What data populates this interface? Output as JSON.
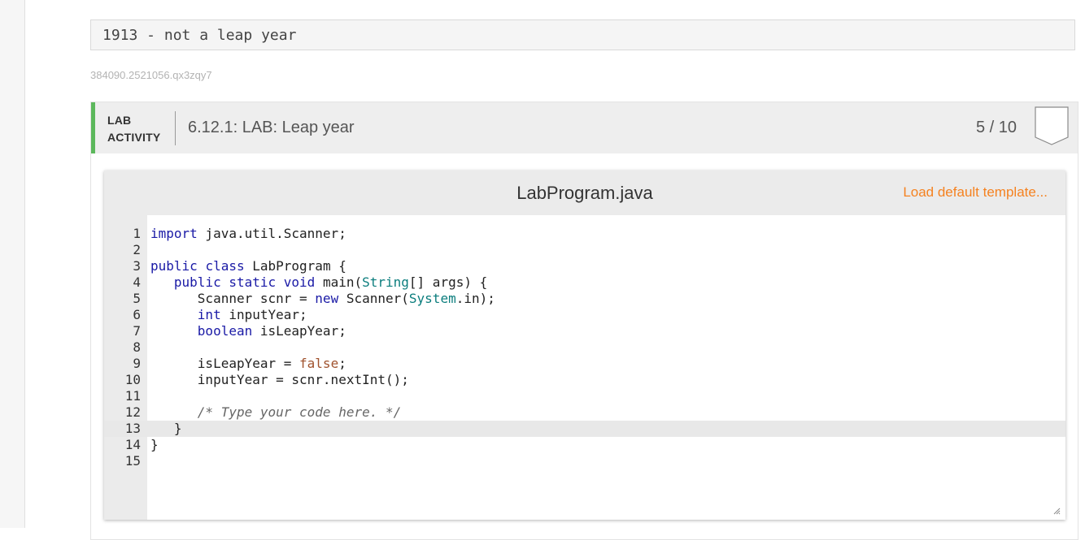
{
  "output": {
    "text": "1913 - not a leap year"
  },
  "activity_id": "384090.2521056.qx3zqy7",
  "lab": {
    "tag_line1": "LAB",
    "tag_line2": "ACTIVITY",
    "title": "6.12.1: LAB: Leap year",
    "score": "5 / 10",
    "accent_color": "#5cb85c"
  },
  "editor": {
    "file_name": "LabProgram.java",
    "load_template_label": "Load default template...",
    "load_template_color": "#f58220",
    "active_line": 13,
    "lines": [
      {
        "num": "1",
        "text": "import java.util.Scanner;"
      },
      {
        "num": "2",
        "text": ""
      },
      {
        "num": "3",
        "text": "public class LabProgram {"
      },
      {
        "num": "4",
        "text": "   public static void main(String[] args) {"
      },
      {
        "num": "5",
        "text": "      Scanner scnr = new Scanner(System.in);"
      },
      {
        "num": "6",
        "text": "      int inputYear;"
      },
      {
        "num": "7",
        "text": "      boolean isLeapYear;"
      },
      {
        "num": "8",
        "text": ""
      },
      {
        "num": "9",
        "text": "      isLeapYear = false;"
      },
      {
        "num": "10",
        "text": "      inputYear = scnr.nextInt();"
      },
      {
        "num": "11",
        "text": ""
      },
      {
        "num": "12",
        "text": "      /* Type your code here. */"
      },
      {
        "num": "13",
        "text": "   }"
      },
      {
        "num": "14",
        "text": "}"
      },
      {
        "num": "15",
        "text": ""
      }
    ]
  },
  "icons": {
    "score_badge": "shield-icon",
    "resize": "resize-handle-icon"
  }
}
